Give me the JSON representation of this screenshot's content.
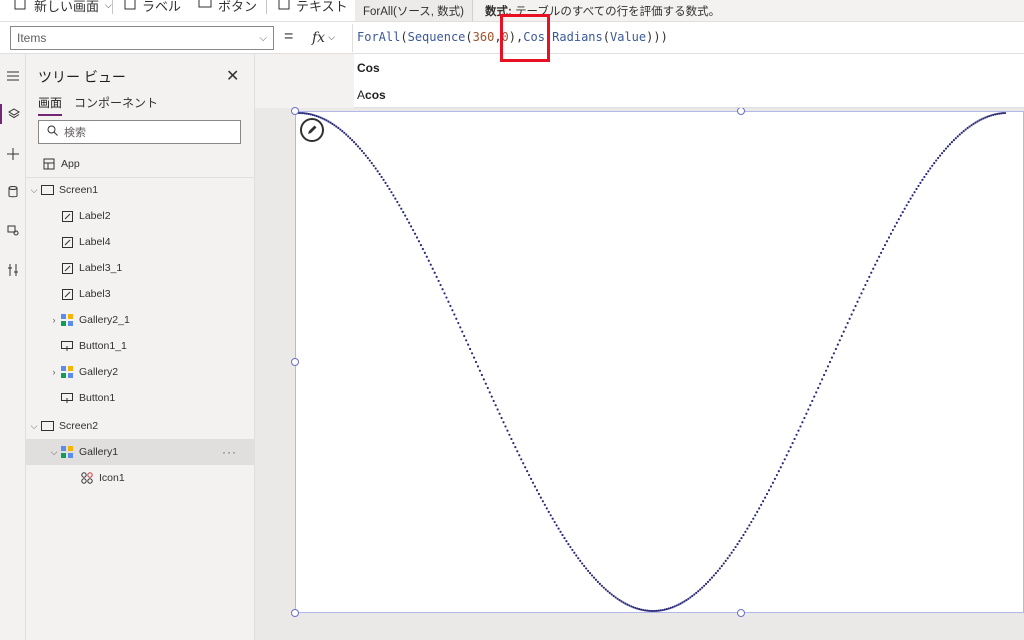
{
  "ribbon": {
    "new_screen": "新しい画面",
    "label": "ラベル",
    "button": "ボタン",
    "text": "テキスト"
  },
  "tooltip": {
    "signature": "ForAll(ソース, 数式)",
    "desc_bold": "数式:",
    "desc_text": "テーブルのすべての行を評価する数式。"
  },
  "formula_bar": {
    "property": "Items",
    "equals": "=",
    "fx": "fx",
    "formula": "ForAll(Sequence(360,0),Cos(Radians(Value)))"
  },
  "suggestions": {
    "item1": "Cos",
    "item2_prefix": "A",
    "item2_bold": "cos"
  },
  "tree": {
    "title": "ツリー ビュー",
    "tab_screens": "画面",
    "tab_components": "コンポーネント",
    "search_placeholder": "検索",
    "app": "App",
    "nodes": [
      {
        "label": "Screen1",
        "type": "screen"
      },
      {
        "label": "Label2",
        "type": "label"
      },
      {
        "label": "Label4",
        "type": "label"
      },
      {
        "label": "Label3_1",
        "type": "label"
      },
      {
        "label": "Label3",
        "type": "label"
      },
      {
        "label": "Gallery2_1",
        "type": "gallery"
      },
      {
        "label": "Button1_1",
        "type": "button"
      },
      {
        "label": "Gallery2",
        "type": "gallery"
      },
      {
        "label": "Button1",
        "type": "button"
      },
      {
        "label": "Screen2",
        "type": "screen"
      },
      {
        "label": "Gallery1",
        "type": "gallery"
      },
      {
        "label": "Icon1",
        "type": "icon"
      }
    ],
    "more": "···"
  },
  "colors": {
    "accent": "#742774",
    "curve": "#2b2a7a",
    "highlight": "#e81123",
    "selection": "#6b6fc9"
  },
  "icons": {
    "rail": [
      "hamburger-icon",
      "layers-icon",
      "plus-icon",
      "database-icon",
      "media-icon",
      "tools-icon"
    ]
  }
}
